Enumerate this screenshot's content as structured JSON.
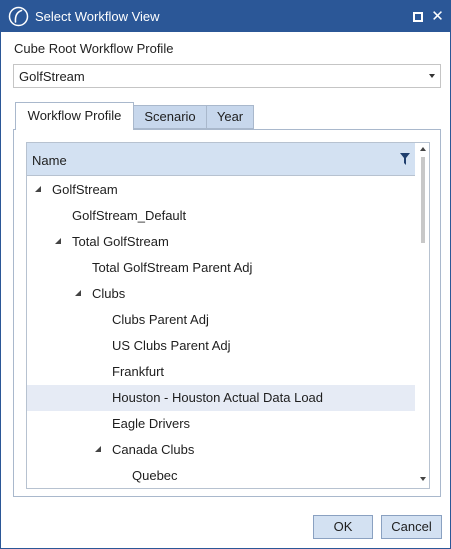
{
  "window": {
    "title": "Select Workflow View",
    "title_bar_color": "#2b5797",
    "icons": {
      "app": "onestream-logo-icon",
      "maximize": "maximize-icon",
      "close": "close-icon"
    },
    "close_glyph": "✕"
  },
  "cube_root": {
    "label": "Cube Root Workflow Profile",
    "selected_value": "GolfStream"
  },
  "tabs": [
    {
      "label": "Workflow Profile",
      "active": true
    },
    {
      "label": "Scenario",
      "active": false
    },
    {
      "label": "Year",
      "active": false
    }
  ],
  "tree": {
    "header": "Name",
    "filter_icon": "filter-icon",
    "rows": [
      {
        "label": "GolfStream",
        "level": 0,
        "expanded": true,
        "selected": false
      },
      {
        "label": "GolfStream_Default",
        "level": 1,
        "expanded": null,
        "selected": false
      },
      {
        "label": "Total GolfStream",
        "level": 1,
        "expanded": true,
        "selected": false
      },
      {
        "label": "Total GolfStream Parent Adj",
        "level": 2,
        "expanded": null,
        "selected": false
      },
      {
        "label": "Clubs",
        "level": 2,
        "expanded": true,
        "selected": false
      },
      {
        "label": "Clubs Parent Adj",
        "level": 3,
        "expanded": null,
        "selected": false
      },
      {
        "label": "US Clubs Parent Adj",
        "level": 3,
        "expanded": null,
        "selected": false
      },
      {
        "label": "Frankfurt",
        "level": 3,
        "expanded": null,
        "selected": false
      },
      {
        "label": "Houston - Houston Actual Data Load",
        "level": 3,
        "expanded": null,
        "selected": true
      },
      {
        "label": "Eagle Drivers",
        "level": 3,
        "expanded": null,
        "selected": false
      },
      {
        "label": "Canada Clubs",
        "level": 3,
        "expanded": true,
        "selected": false
      },
      {
        "label": "Quebec",
        "level": 4,
        "expanded": null,
        "selected": false
      }
    ]
  },
  "buttons": {
    "ok": "OK",
    "cancel": "Cancel"
  },
  "colors": {
    "accent": "#2b5797",
    "tab_inactive": "#c7d7ec",
    "header_bg": "#d3e1f2",
    "selected_row": "#e6ebf5"
  }
}
